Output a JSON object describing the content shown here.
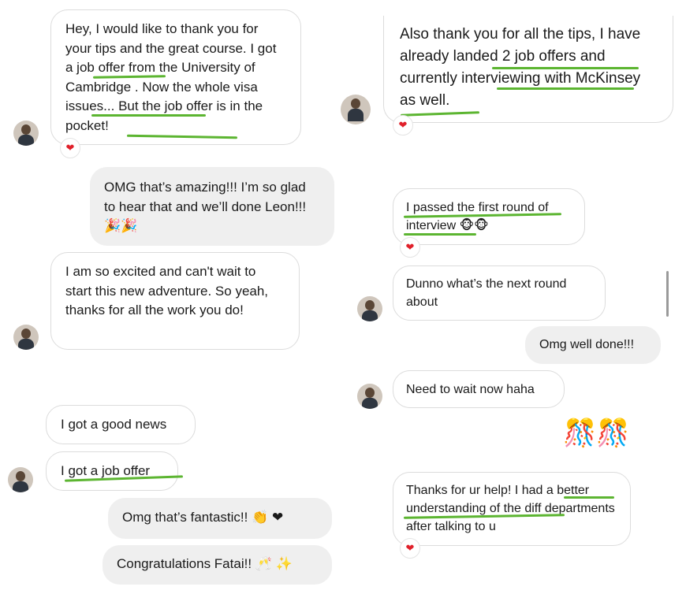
{
  "left_panel": {
    "messages": [
      {
        "id": "m1",
        "type": "received",
        "text": "Hey, I would like to thank you for your tips and the great course. I got a job offer from the University of Cambridge . Now the whole visa issues... But the job offer is in the pocket!",
        "reaction": "❤"
      },
      {
        "id": "m2",
        "type": "sent",
        "text": "OMG that’s amazing!!! I’m so glad to hear that and we’ll done Leon!!! 🎉🎉"
      },
      {
        "id": "m3",
        "type": "received",
        "text": "I am so excited and can't wait to start this new adventure. So yeah, thanks for all the work you do!"
      },
      {
        "id": "m4",
        "type": "received",
        "text": "I got a good news"
      },
      {
        "id": "m5",
        "type": "received",
        "text": "I got a job offer"
      },
      {
        "id": "m6",
        "type": "sent",
        "text": "Omg that’s fantastic!! 👏 ❤"
      },
      {
        "id": "m7",
        "type": "sent",
        "text": "Congratulations Fatai!! 🥂 ✨"
      }
    ]
  },
  "right_panel": {
    "messages": [
      {
        "id": "r1",
        "type": "received",
        "text": "Also thank you for all the tips, I have already landed 2 job offers and currently interviewing with McKinsey as well.",
        "reaction": "❤"
      },
      {
        "id": "r2",
        "type": "received",
        "text": "I passed the first round of interview 🐵🐵",
        "reaction": "❤"
      },
      {
        "id": "r3",
        "type": "received",
        "text": "Dunno what’s the next round about"
      },
      {
        "id": "r4",
        "type": "sent",
        "text": "Omg well done!!!"
      },
      {
        "id": "r5",
        "type": "received",
        "text": "Need to wait now haha"
      },
      {
        "id": "r6",
        "type": "sticker",
        "text": "🎊🎊"
      },
      {
        "id": "r7",
        "type": "received",
        "text": "Thanks for ur help! I had a better understanding of the diff departments after talking to u",
        "reaction": "❤"
      }
    ]
  },
  "colors": {
    "highlight": "#5cb531",
    "reaction": "#e0202a",
    "sent_bubble": "#efefef",
    "received_border": "#dcdcdc"
  }
}
